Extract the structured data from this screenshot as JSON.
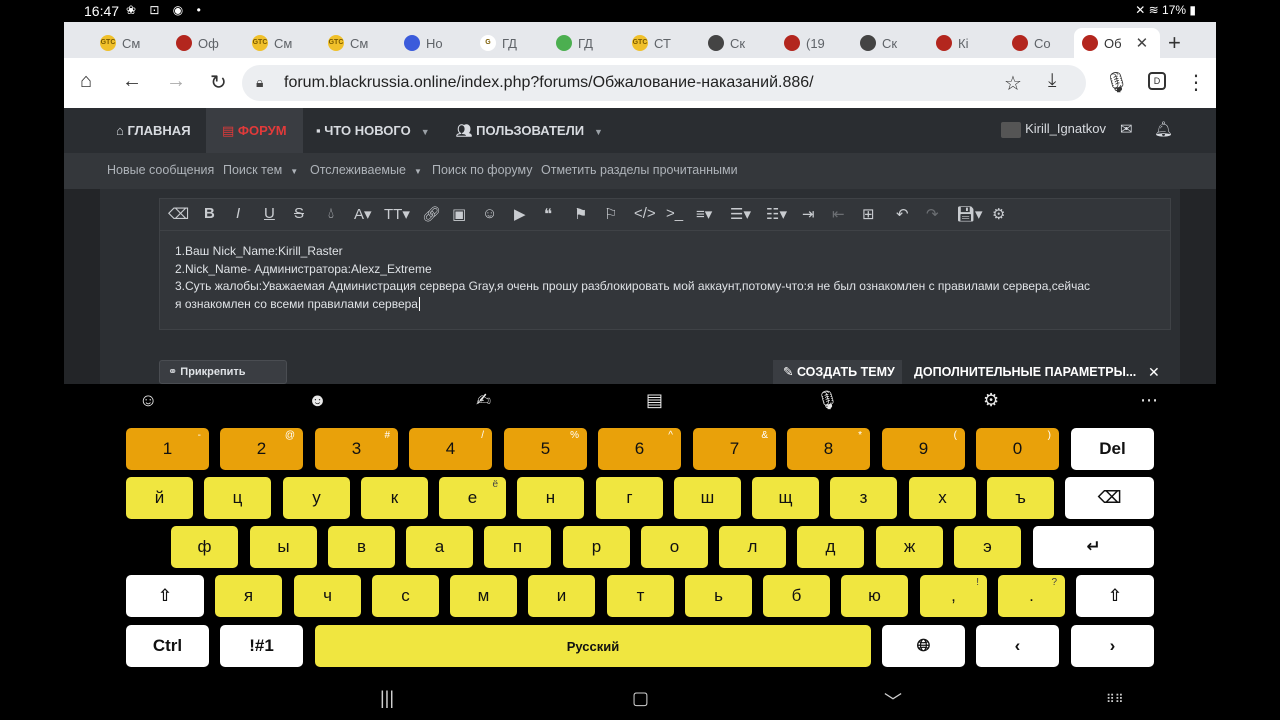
{
  "status": {
    "time": "16:47",
    "battery": "17%"
  },
  "tabs": [
    {
      "label": "См",
      "fav": "#f0c02a",
      "favtext": "GTC"
    },
    {
      "label": "Оф",
      "fav": "#b3261e",
      "favtext": ""
    },
    {
      "label": "См",
      "fav": "#f0c02a",
      "favtext": "GTC"
    },
    {
      "label": "См",
      "fav": "#f0c02a",
      "favtext": "GTC"
    },
    {
      "label": "Но",
      "fav": "#3b5bdb",
      "favtext": ""
    },
    {
      "label": "ГД",
      "fav": "#ffffff",
      "favtext": "G"
    },
    {
      "label": "ГД",
      "fav": "#4caf50",
      "favtext": ""
    },
    {
      "label": "СТ",
      "fav": "#f0c02a",
      "favtext": "GTC"
    },
    {
      "label": "Ск",
      "fav": "#444",
      "favtext": ""
    },
    {
      "label": "(19",
      "fav": "#b3261e",
      "favtext": ""
    },
    {
      "label": "Ск",
      "fav": "#444",
      "favtext": ""
    },
    {
      "label": "Кі",
      "fav": "#b3261e",
      "favtext": ""
    },
    {
      "label": "Со",
      "fav": "#b3261e",
      "favtext": ""
    },
    {
      "label": "Об",
      "fav": "#b3261e",
      "favtext": "",
      "active": true
    }
  ],
  "urlbar": {
    "url": "forum.blackrussia.online/index.php?forums/Обжалование-наказаний.886/"
  },
  "forumnav": {
    "home": "ГЛАВНАЯ",
    "forum": "ФОРУМ",
    "whatsnew": "ЧТО НОВОГО",
    "users": "ПОЛЬЗОВАТЕЛИ",
    "username": "Kirill_Ignatkov"
  },
  "subnav": {
    "new_messages": "Новые сообщения",
    "search_topics": "Поиск тем",
    "watched": "Отслеживаемые",
    "search_forum": "Поиск по форуму",
    "mark_read": "Отметить разделы прочитанными"
  },
  "editor": {
    "line1": "1.Ваш Nick_Name:Kirill_Raster",
    "line2": "2.Nick_Name- Администратора:Alexz_Extreme",
    "line3": "3.Суть жалобы:Уважаемая Администрация сервера Gray,я очень прошу разблокировать мой аккаунт,потому-что:я не был ознакомлен с правилами сервера,сейчас",
    "line4": "я ознакомлен со всеми правилами сервера"
  },
  "actions": {
    "attach": "Прикрепить файлы",
    "create": "СОЗДАТЬ ТЕМУ",
    "more": "ДОПОЛНИТЕЛЬНЫЕ ПАРАМЕТРЫ..."
  },
  "keyboard": {
    "numbers": [
      {
        "k": "1",
        "s": "-"
      },
      {
        "k": "2",
        "s": "@"
      },
      {
        "k": "3",
        "s": "#"
      },
      {
        "k": "4",
        "s": "/"
      },
      {
        "k": "5",
        "s": "%"
      },
      {
        "k": "6",
        "s": "^"
      },
      {
        "k": "7",
        "s": "&"
      },
      {
        "k": "8",
        "s": "*"
      },
      {
        "k": "9",
        "s": "("
      },
      {
        "k": "0",
        "s": ")"
      }
    ],
    "row2": [
      "й",
      "ц",
      "у",
      "к",
      "е",
      "н",
      "г",
      "ш",
      "щ",
      "з",
      "х",
      "ъ"
    ],
    "row3": [
      "ф",
      "ы",
      "в",
      "а",
      "п",
      "р",
      "о",
      "л",
      "д",
      "ж",
      "э"
    ],
    "row4": [
      "я",
      "ч",
      "с",
      "м",
      "и",
      "т",
      "ь",
      "б",
      "ю"
    ],
    "del": "Del",
    "ctrl": "Ctrl",
    "sym": "!#1",
    "space": "Русский",
    "comma": ",",
    "comma_sub": "!",
    "period": ".",
    "period_sub": "?",
    "e_sub": "ё"
  }
}
